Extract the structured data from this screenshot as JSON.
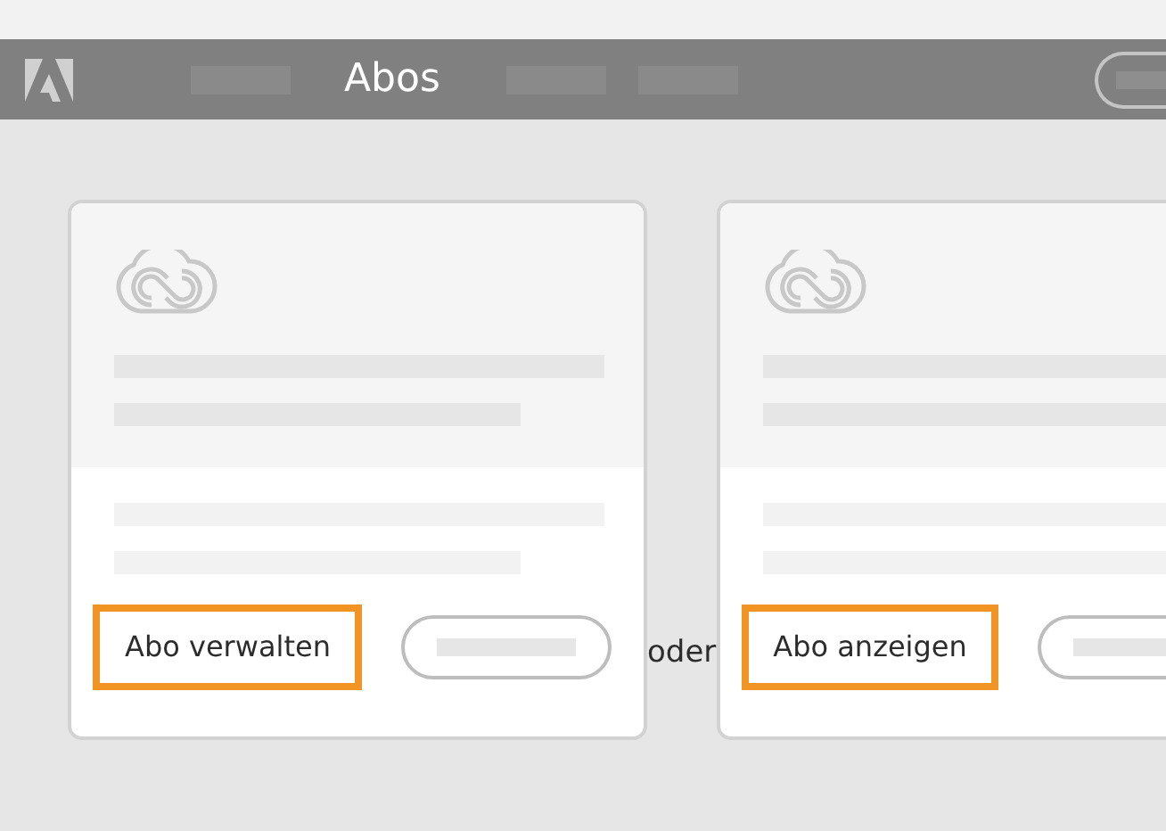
{
  "navbar": {
    "title": "Abos"
  },
  "cards": [
    {
      "action": {
        "label": "Abo verwalten",
        "highlighted": true
      }
    },
    {
      "action": {
        "label": "Abo anzeigen",
        "highlighted": true
      }
    }
  ],
  "separator": "oder"
}
